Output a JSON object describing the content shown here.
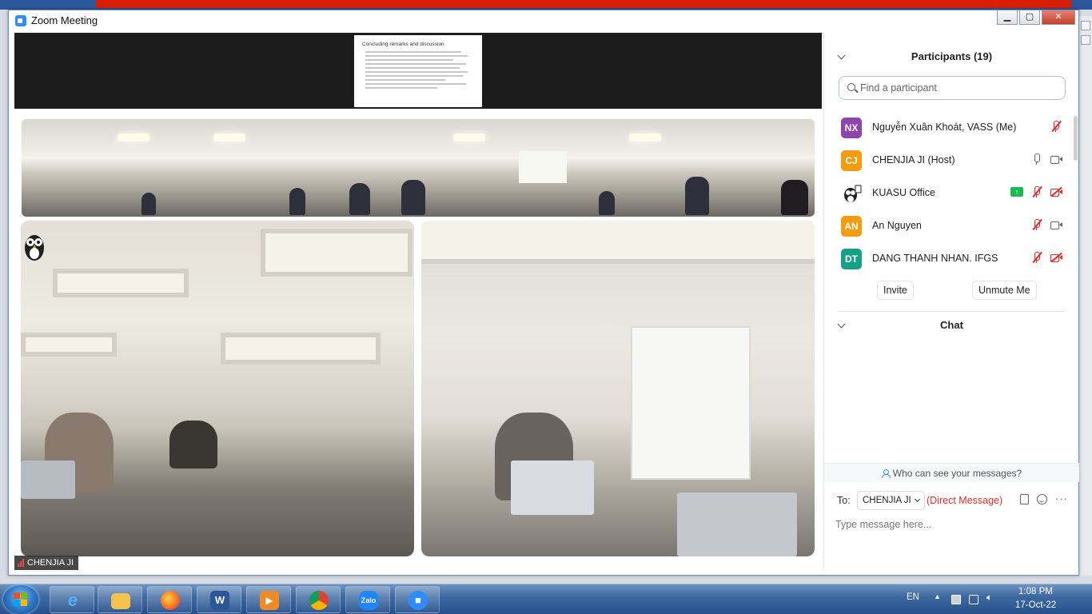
{
  "window": {
    "title": "Zoom Meeting",
    "min_glyph": "▁",
    "max_glyph": "▢",
    "close_glyph": "✕"
  },
  "shared_slide": {
    "title": "Concluding remarks and discussion"
  },
  "active_speaker": {
    "name": "CHENJIA JI"
  },
  "participants": {
    "header": "Participants (19)",
    "search_placeholder": "Find a participant",
    "list": [
      {
        "initials": "NX",
        "name": "Nguyễn Xuân Khoát, VASS (Me)",
        "color": "#8e44ad"
      },
      {
        "initials": "CJ",
        "name": "CHENJIA JI (Host)",
        "color": "#f39c12"
      },
      {
        "initials": "",
        "name": "KUASU Office",
        "color": "#ffffff"
      },
      {
        "initials": "AN",
        "name": "An Nguyen",
        "color": "#f39c12"
      },
      {
        "initials": "DT",
        "name": "DANG THANH NHAN. IFGS",
        "color": "#16a085"
      }
    ],
    "invite_label": "Invite",
    "unmute_label": "Unmute Me",
    "share_glyph": "↑"
  },
  "chat": {
    "header": "Chat",
    "who_can_see": "Who can see your messages?",
    "to_label": "To:",
    "to_value": "CHENJIA JI",
    "direct_message": "(Direct Message)",
    "placeholder": "Type message here...",
    "more_glyph": "···"
  },
  "taskbar": {
    "word_glyph": "W",
    "zalo_label": "Zalo",
    "language": "EN",
    "time": "1:08 PM",
    "date": "17-Oct-22"
  },
  "colors": {
    "zoom_blue": "#2d8cff",
    "muted_red": "#e02828",
    "direct_message_red": "#d92e2e"
  }
}
